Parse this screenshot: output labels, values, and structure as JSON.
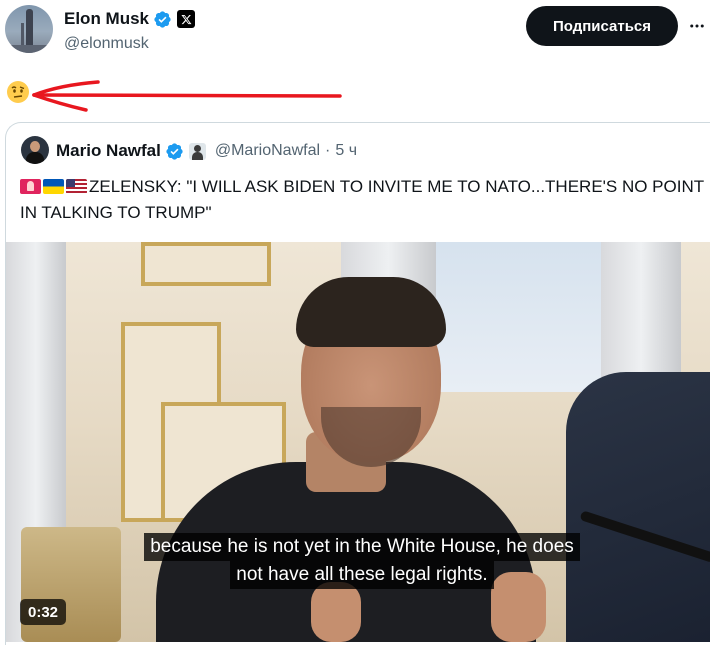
{
  "post": {
    "author_name": "Elon Musk",
    "author_handle": "@elonmusk",
    "follow_label": "Подписаться",
    "emoji": "🤨"
  },
  "quoted": {
    "author_name": "Mario Nawfal",
    "author_handle": "@MarioNawfal",
    "separator": "·",
    "time": "5 ч",
    "text": "ZELENSKY: \"I WILL ASK BIDEN TO INVITE ME TO NATO...THERE'S NO POINT IN TALKING TO TRUMP\"",
    "text_flags": [
      "siren",
      "ukraine-flag",
      "us-flag"
    ]
  },
  "video": {
    "subtitle_lines": [
      "because he is not yet in the White House, he does",
      "not have all these legal rights."
    ],
    "duration": "0:32"
  },
  "colors": {
    "verified_blue": "#1d9bf0",
    "annotation_red": "#e8171f",
    "follow_button_bg": "#0f1419",
    "secondary_text": "#536471"
  },
  "icons": {
    "verified": "verified-badge-icon",
    "affiliate": "x-logo-icon",
    "more": "more-horizontal-icon"
  }
}
